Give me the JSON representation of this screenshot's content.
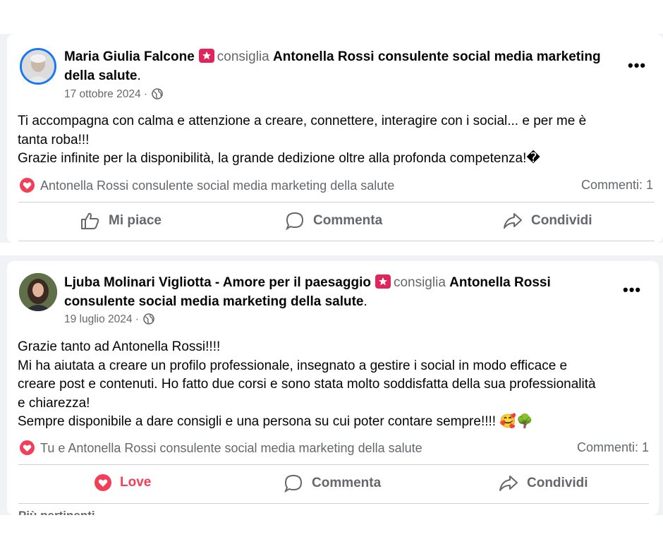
{
  "posts": [
    {
      "author": "Maria Giulia Falcone",
      "verb": "consiglia",
      "page_line1": "Antonella Rossi consulente social media marketing",
      "page_line2": "della salute",
      "period": ".",
      "date": "17 ottobre 2024 ·",
      "body": [
        "Ti accompagna con calma e attenzione a creare, connettere, interagire con i social... e per me è",
        "tanta roba!!!",
        "Grazie infinite per la disponibilità, la grande dedizione oltre alla profonda competenza!�"
      ],
      "reactors": "Antonella Rossi consulente social media marketing della salute",
      "comments": "Commenti: 1",
      "actions": {
        "like": "Mi piace",
        "comment": "Commenta",
        "share": "Condividi"
      }
    },
    {
      "author": "Ljuba Molinari Vigliotta - Amore per il paesaggio",
      "verb": "consiglia",
      "page_line1": "Antonella Rossi",
      "page_line2": "consulente social media marketing della salute",
      "period": ".",
      "date": "19 luglio 2024 ·",
      "body": [
        "Grazie tanto ad Antonella Rossi!!!!",
        "Mi ha aiutata a creare un profilo professionale, insegnato a gestire i social in modo efficace e",
        "creare post e contenuti. Ho fatto due corsi e sono stata molto soddisfatta della sua professionalità",
        "e chiarezza!",
        "Sempre disponibile a dare consigli e una persona su cui poter contare sempre!!!! 🥰🌳"
      ],
      "reactors": "Tu e Antonella Rossi consulente social media marketing della salute",
      "comments": "Commenti: 1",
      "actions": {
        "like": "Love",
        "comment": "Commenta",
        "share": "Condividi"
      }
    }
  ],
  "cut_off_text": "Più pertinenti",
  "icons": {
    "recommend": "recommend-icon",
    "globe": "globe-icon",
    "more": "more-icon",
    "heart": "heart-icon",
    "like": "thumbs-up-icon",
    "comment": "comment-icon",
    "share": "share-icon"
  },
  "colors": {
    "love": "#f33e58",
    "recommend": "#e0245e",
    "muted": "#65676b"
  }
}
